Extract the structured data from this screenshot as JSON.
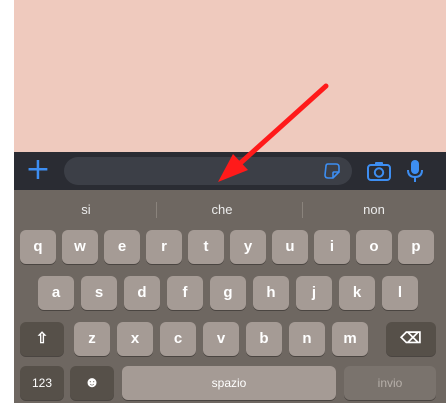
{
  "composer": {
    "plus_icon": "+",
    "input_value": "",
    "sticker_icon": "sticker-icon",
    "camera_icon": "camera-icon",
    "mic_icon": "microphone-icon"
  },
  "annotation": {
    "arrow_color": "#ff1a1a"
  },
  "keyboard": {
    "suggestions": [
      "si",
      "che",
      "non"
    ],
    "row1": [
      "q",
      "w",
      "e",
      "r",
      "t",
      "y",
      "u",
      "i",
      "o",
      "p"
    ],
    "row2": [
      "a",
      "s",
      "d",
      "f",
      "g",
      "h",
      "j",
      "k",
      "l"
    ],
    "row3": [
      "z",
      "x",
      "c",
      "v",
      "b",
      "n",
      "m"
    ],
    "shift_icon": "⇧",
    "backspace_icon": "⌫",
    "numbers_label": "123",
    "emoji_icon": "☻",
    "space_label": "spazio",
    "send_label": "invio"
  },
  "colors": {
    "chat_background": "#efcabe",
    "composer_bar": "#2a2c33",
    "accent_blue": "#3d8ef2",
    "keyboard_background": "#6e6761",
    "key_light": "#a59b95",
    "key_dark": "#565049"
  }
}
